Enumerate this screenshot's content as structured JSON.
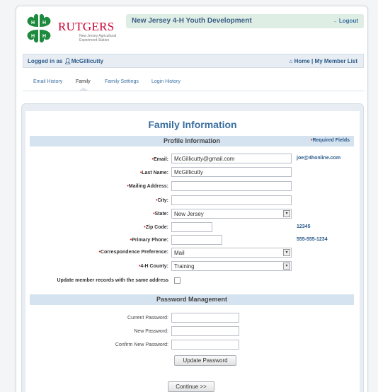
{
  "header": {
    "brand": "RUTGERS",
    "brand_sub": "New Jersey Agricultural Experiment Station",
    "title": "New Jersey 4-H Youth Development",
    "logout_label": "Logout"
  },
  "login_bar": {
    "logged_in_prefix": "Logged in as",
    "user_name": "McGillicutty",
    "home_label": "Home",
    "separator": "|",
    "member_list_label": "My Member List"
  },
  "tabs": [
    {
      "label": "Email History"
    },
    {
      "label": "Family"
    },
    {
      "label": "Family Settings"
    },
    {
      "label": "Login History"
    }
  ],
  "page": {
    "title": "Family Information"
  },
  "profile": {
    "section_title": "Profile Information",
    "required_note": "Required Fields",
    "email_label": "Email:",
    "email_value": "McGillicutty@gmail.com",
    "email_hint": "joe@4honline.com",
    "last_name_label": "Last Name:",
    "last_name_value": "McGillicutty",
    "mailing_label": "Mailing Address:",
    "mailing_value": "",
    "city_label": "City:",
    "city_value": "",
    "state_label": "State:",
    "state_value": "New Jersey",
    "zip_label": "Zip Code:",
    "zip_value": "",
    "zip_hint": "12345",
    "phone_label": "Primary Phone:",
    "phone_value": "",
    "phone_hint": "555-555-1234",
    "corr_label": "Correspondence Preference:",
    "corr_value": "Mail",
    "county_label": "4-H County:",
    "county_value": "Training",
    "update_members_label": "Update member records with the same address"
  },
  "password": {
    "section_title": "Password Management",
    "current_label": "Current Password:",
    "new_label": "New Password:",
    "confirm_label": "Confirm New Password:",
    "update_button": "Update Password"
  },
  "footer": {
    "continue_button": "Continue >>"
  },
  "colors": {
    "brand_red": "#cc0033",
    "clover_green": "#1e8a3e",
    "link_blue": "#3a6fa0",
    "required_red": "#d8262a"
  }
}
